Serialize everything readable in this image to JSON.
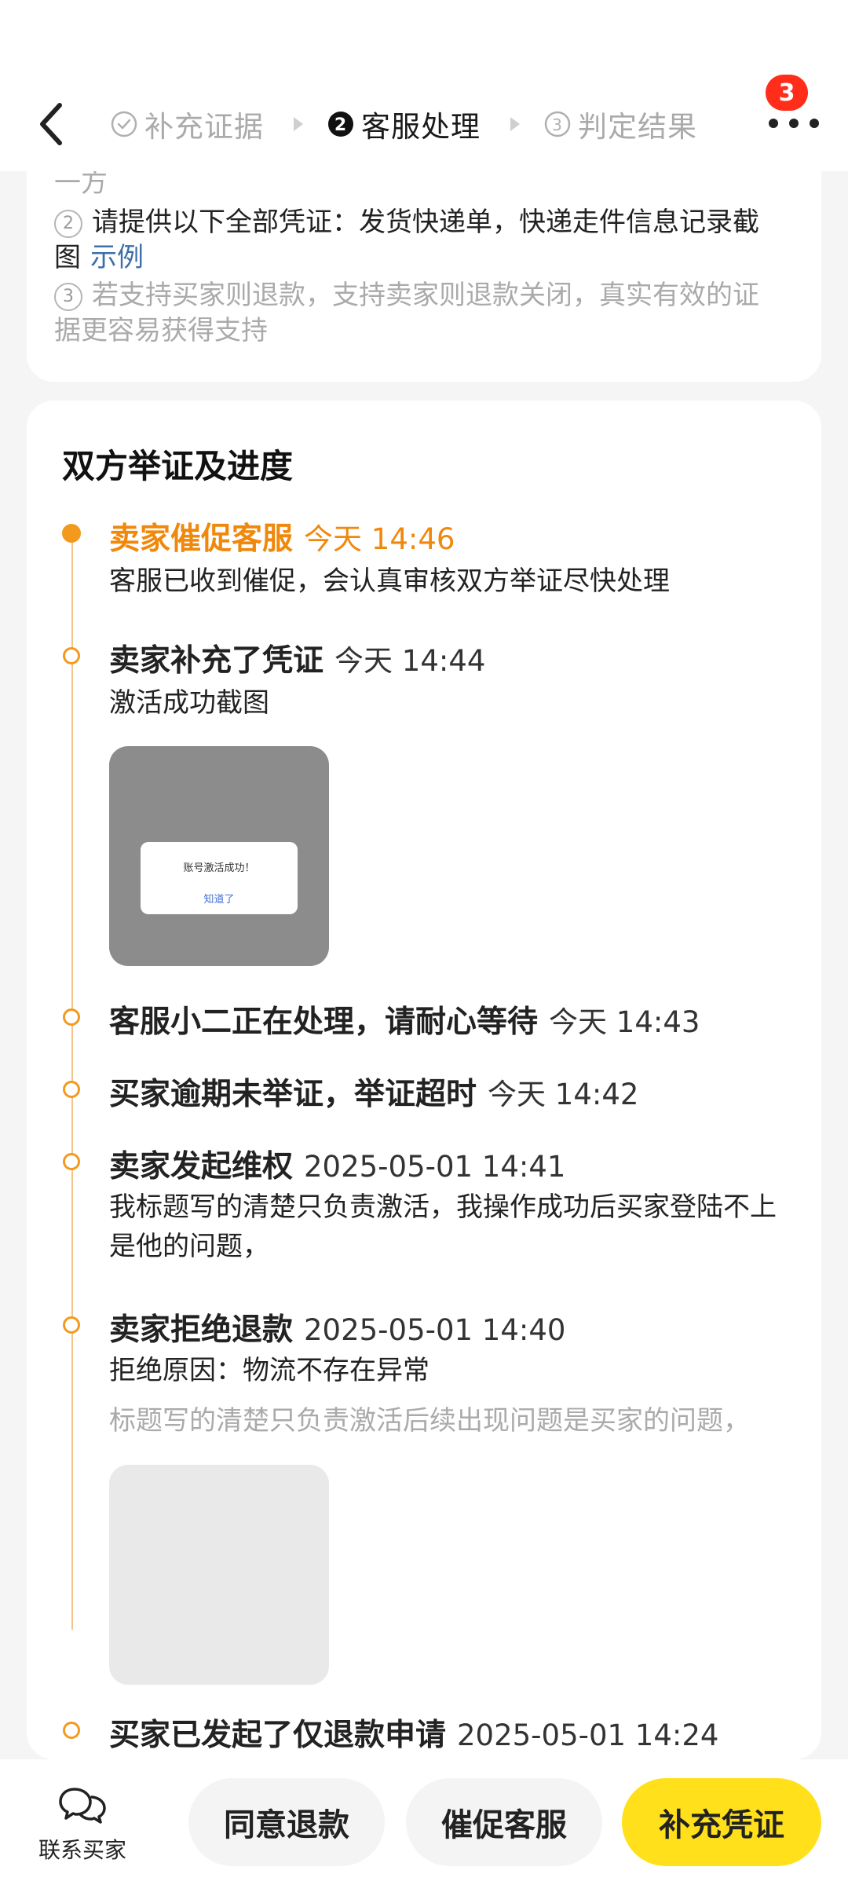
{
  "header": {
    "steps": [
      {
        "label": "补充证据",
        "state": "done"
      },
      {
        "label": "客服处理",
        "state": "active",
        "num": "2"
      },
      {
        "label": "判定结果",
        "state": "todo",
        "num": "3"
      }
    ],
    "badge_count": "3"
  },
  "info": {
    "line0": "一方",
    "item2_num": "2",
    "item2_text": "请提供以下全部凭证：发货快递单，快递走件信息记录截",
    "item2_cont": "图",
    "item2_link": "示例",
    "item3_num": "3",
    "item3_text": "若支持买家则退款，支持卖家则退款关闭，真实有效的证",
    "item3_cont": "据更容易获得支持"
  },
  "progress": {
    "title": "双方举证及进度",
    "items": [
      {
        "title": "卖家催促客服",
        "time": "今天 14:46",
        "desc": "客服已收到催促，会认真审核双方举证尽快处理"
      },
      {
        "title": "卖家补充了凭证",
        "time": "今天 14:44",
        "desc": "激活成功截图",
        "image_modal_title": "账号激活成功！",
        "image_modal_button": "知道了"
      },
      {
        "title": "客服小二正在处理，请耐心等待",
        "time": "今天 14:43"
      },
      {
        "title": "买家逾期未举证，举证超时",
        "time": "今天 14:42"
      },
      {
        "title": "卖家发起维权",
        "time": "2025-05-01 14:41",
        "desc_line1": "我标题写的清楚只负责激活，我操作成功后买家登陆不上",
        "desc_line2": "是他的问题，"
      },
      {
        "title": "卖家拒绝退款",
        "time": "2025-05-01 14:40",
        "desc": "拒绝原因：物流不存在异常",
        "desc_gray": "标题写的清楚只负责激活后续出现问题是买家的问题，"
      },
      {
        "title": "买家已发起了仅退款申请",
        "time": "2025-05-01 14:24"
      }
    ]
  },
  "bottom": {
    "contact_label": "联系买家",
    "agree_label": "同意退款",
    "urge_label": "催促客服",
    "evidence_label": "补充凭证"
  },
  "colors": {
    "accent": "#f0880c",
    "primary_button": "#ffe01a",
    "badge": "#ff2d1a",
    "link": "#3f6fa8"
  }
}
